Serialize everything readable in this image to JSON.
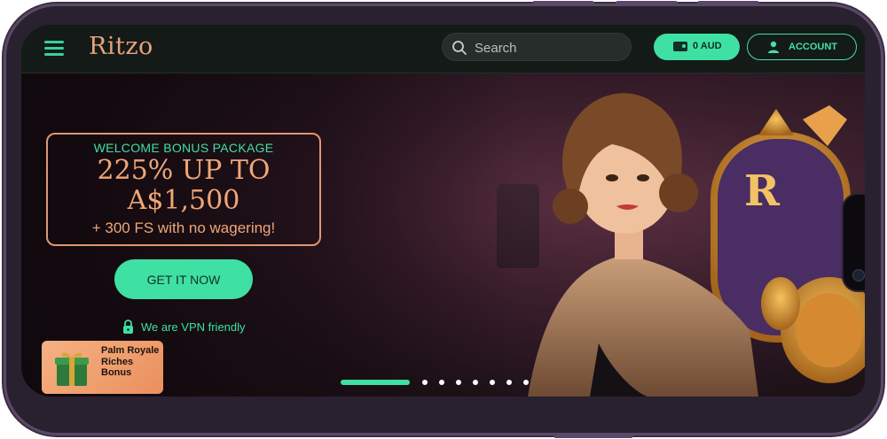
{
  "header": {
    "logo": "Ritzo",
    "search_placeholder": "Search",
    "balance_label": "0 AUD",
    "account_label": "ACCOUNT"
  },
  "hero": {
    "bonus_title": "WELCOME BONUS PACKAGE",
    "bonus_line1": "225% UP TO",
    "bonus_line2": "A$1,500",
    "bonus_sub": "+ 300 FS with no wagering!",
    "cta_label": "GET IT NOW",
    "vpn_text": "We are VPN friendly",
    "badge_letter": "R"
  },
  "promo": {
    "label": "Palm Royale Riches Bonus"
  },
  "carousel": {
    "slide_count": 8,
    "active_index": 0
  },
  "colors": {
    "accent": "#3fe0a3",
    "brand_copper": "#f0a677",
    "header_bg": "#141a17"
  }
}
